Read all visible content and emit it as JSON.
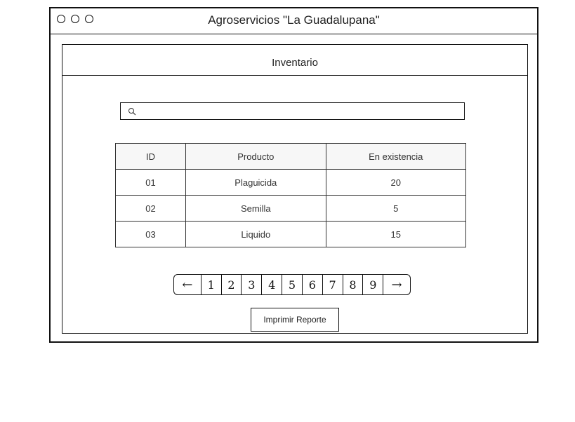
{
  "window": {
    "title": "Agroservicios \"La Guadalupana\""
  },
  "panel": {
    "title": "Inventario"
  },
  "search": {
    "placeholder": "",
    "value": "",
    "icon": "search-icon"
  },
  "table": {
    "columns": [
      "ID",
      "Producto",
      "En existencia"
    ],
    "rows": [
      [
        "01",
        "Plaguicida",
        "20"
      ],
      [
        "02",
        "Semilla",
        "5"
      ],
      [
        "03",
        "Liquido",
        "15"
      ]
    ]
  },
  "pagination": {
    "prev_icon": "arrow-left-icon",
    "next_icon": "arrow-right-icon",
    "prev": "←",
    "next": "→",
    "pages": [
      "1",
      "2",
      "3",
      "4",
      "5",
      "6",
      "7",
      "8",
      "9"
    ]
  },
  "actions": {
    "print_label": "Imprimir Reporte"
  }
}
